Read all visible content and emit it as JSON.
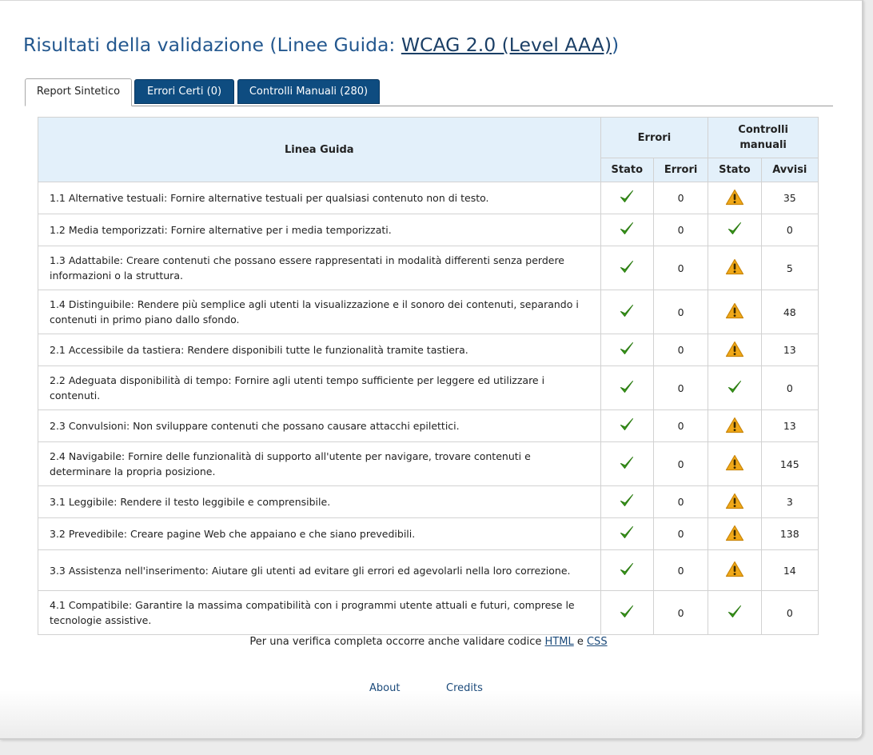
{
  "title": {
    "prefix": "Risultati della validazione (Linee Guida: ",
    "link": "WCAG 2.0 (Level AAA)",
    "suffix": ")"
  },
  "tabs": [
    {
      "label": "Report Sintetico",
      "active": true
    },
    {
      "label": "Errori Certi (0)",
      "active": false
    },
    {
      "label": "Controlli Manuali (280)",
      "active": false
    }
  ],
  "table": {
    "headers": {
      "guideline": "Linea Guida",
      "errors_group": "Errori",
      "manual_group": "Controlli manuali",
      "stato": "Stato",
      "errori": "Errori",
      "avvisi": "Avvisi"
    },
    "rows": [
      {
        "guideline": "1.1 Alternative testuali: Fornire alternative testuali per qualsiasi contenuto non di testo.",
        "err_status": "ok",
        "errors": "0",
        "manual_status": "warning",
        "warnings": "35"
      },
      {
        "guideline": "1.2 Media temporizzati: Fornire alternative per i media temporizzati.",
        "err_status": "ok",
        "errors": "0",
        "manual_status": "ok",
        "warnings": "0"
      },
      {
        "guideline": "1.3 Adattabile: Creare contenuti che possano essere rappresentati in modalità differenti senza perdere informazioni o la struttura.",
        "err_status": "ok",
        "errors": "0",
        "manual_status": "warning",
        "warnings": "5"
      },
      {
        "guideline": "1.4 Distinguibile: Rendere più semplice agli utenti la visualizzazione e il sonoro dei contenuti, separando i contenuti in primo piano dallo sfondo.",
        "err_status": "ok",
        "errors": "0",
        "manual_status": "warning",
        "warnings": "48"
      },
      {
        "guideline": "2.1 Accessibile da tastiera: Rendere disponibili tutte le funzionalità tramite tastiera.",
        "err_status": "ok",
        "errors": "0",
        "manual_status": "warning",
        "warnings": "13"
      },
      {
        "guideline": "2.2 Adeguata disponibilità di tempo: Fornire agli utenti tempo sufficiente per leggere ed utilizzare i contenuti.",
        "err_status": "ok",
        "errors": "0",
        "manual_status": "ok",
        "warnings": "0"
      },
      {
        "guideline": "2.3 Convulsioni: Non sviluppare contenuti che possano causare attacchi epilettici.",
        "err_status": "ok",
        "errors": "0",
        "manual_status": "warning",
        "warnings": "13"
      },
      {
        "guideline": "2.4 Navigabile: Fornire delle funzionalità di supporto all'utente per navigare, trovare contenuti e determinare la propria posizione.",
        "err_status": "ok",
        "errors": "0",
        "manual_status": "warning",
        "warnings": "145"
      },
      {
        "guideline": "3.1 Leggibile: Rendere il testo leggibile e comprensibile.",
        "err_status": "ok",
        "errors": "0",
        "manual_status": "warning",
        "warnings": "3"
      },
      {
        "guideline": "3.2 Prevedibile: Creare pagine Web che appaiano e che siano prevedibili.",
        "err_status": "ok",
        "errors": "0",
        "manual_status": "warning",
        "warnings": "138"
      },
      {
        "guideline": "3.3 Assistenza nell'inserimento: Aiutare gli utenti ad evitare gli errori ed agevolarli nella loro correzione.",
        "err_status": "ok",
        "errors": "0",
        "manual_status": "warning",
        "warnings": "14"
      },
      {
        "guideline": "4.1 Compatibile: Garantire la massima compatibilità con i programmi utente attuali e futuri, comprese le tecnologie assistive.",
        "err_status": "ok",
        "errors": "0",
        "manual_status": "ok",
        "warnings": "0"
      }
    ]
  },
  "footer": {
    "note_prefix": "Per una verifica completa occorre anche validare codice ",
    "html_link": "HTML",
    "note_and": " e ",
    "css_link": "CSS",
    "about": "About",
    "credits": "Credits"
  },
  "icons": {
    "ok": "checkmark-icon",
    "warning": "warning-icon"
  },
  "colors": {
    "title": "#24588f",
    "tab_blue": "#0e4c80",
    "header_bg": "#e3f0fa",
    "check": "#3a9a1c",
    "warning": "#f0a818"
  }
}
